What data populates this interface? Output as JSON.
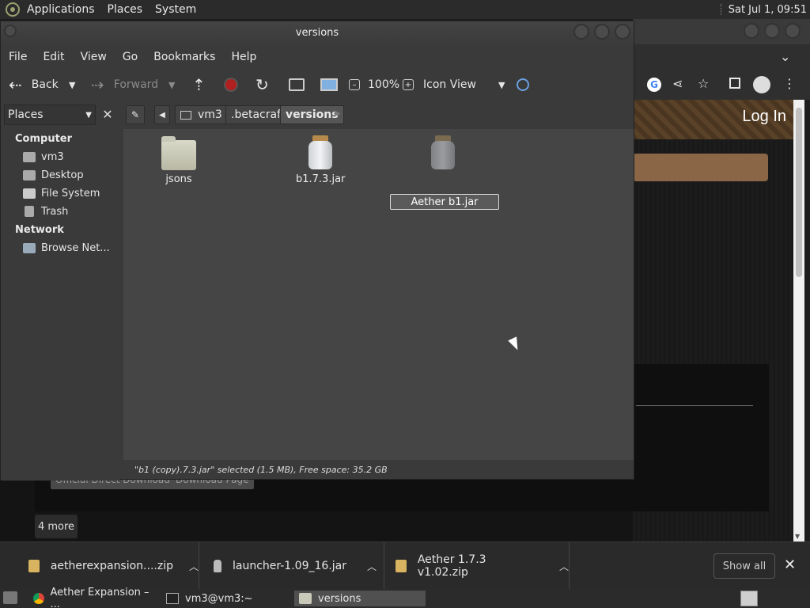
{
  "top_panel": {
    "menus": [
      "Applications",
      "Places",
      "System"
    ],
    "clock": "Sat Jul 1, 09:51"
  },
  "browser": {
    "login": "Log In",
    "buttons": [
      "Official Direct Download",
      "Download Page"
    ],
    "more": "4 more",
    "download_shelf": {
      "items": [
        {
          "name": "aetherexpansion....zip",
          "icon": "archive-file-icon"
        },
        {
          "name": "launcher-1.09_16.jar",
          "icon": "jar-file-icon"
        },
        {
          "name": "Aether 1.7.3 v1.02.zip",
          "icon": "archive-file-icon"
        }
      ],
      "show_all": "Show all",
      "close": "✕"
    }
  },
  "taskbar": {
    "tasks": [
      {
        "label": "Aether Expansion – ...",
        "icon": "chrome-icon"
      },
      {
        "label": "vm3@vm3:~",
        "icon": "terminal-icon"
      },
      {
        "label": "versions",
        "icon": "folder-icon"
      }
    ]
  },
  "file_manager": {
    "title": "versions",
    "menu": [
      "File",
      "Edit",
      "View",
      "Go",
      "Bookmarks",
      "Help"
    ],
    "toolbar": {
      "back": "Back",
      "forward": "Forward",
      "zoom": "100%",
      "view_mode": "Icon View"
    },
    "places_selector": "Places",
    "breadcrumb": [
      "vm3",
      ".betacraft",
      "versions"
    ],
    "sidebar": {
      "sections": [
        {
          "title": "Computer",
          "items": [
            "vm3",
            "Desktop",
            "File System",
            "Trash"
          ]
        },
        {
          "title": "Network",
          "items": [
            "Browse Net..."
          ]
        }
      ]
    },
    "files": [
      {
        "name": "jsons",
        "type": "folder"
      },
      {
        "name": "b1.7.3.jar",
        "type": "jar"
      },
      {
        "name": "Aether b1.jar",
        "type": "jar",
        "renaming": true
      }
    ],
    "status": "\"b1 (copy).7.3.jar\" selected (1.5 MB), Free space: 35.2 GB"
  }
}
